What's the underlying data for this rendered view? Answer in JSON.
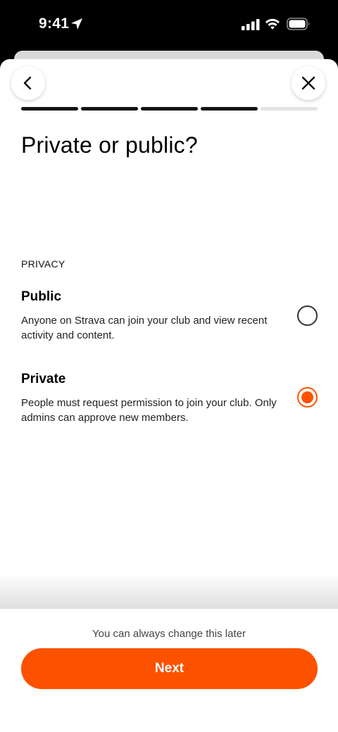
{
  "status_bar": {
    "time": "9:41",
    "icons": [
      "location-arrow-icon",
      "cellular-signal-icon",
      "wifi-icon",
      "battery-icon"
    ]
  },
  "nav": {
    "back_icon": "chevron-left-icon",
    "close_icon": "close-icon"
  },
  "progress": {
    "steps_total": 5,
    "steps_completed": 4
  },
  "page": {
    "title": "Private or public?",
    "section_label": "PRIVACY"
  },
  "options": [
    {
      "title": "Public",
      "description": "Anyone on Strava can join your club and view recent activity and content.",
      "selected": false
    },
    {
      "title": "Private",
      "description": "People must request permission to join your club. Only admins can approve new members.",
      "selected": true
    }
  ],
  "footer": {
    "hint": "You can always change this later",
    "next_label": "Next"
  },
  "colors": {
    "accent": "#fc5200",
    "progress_done": "#111111",
    "progress_todo": "#e3e3e3"
  }
}
